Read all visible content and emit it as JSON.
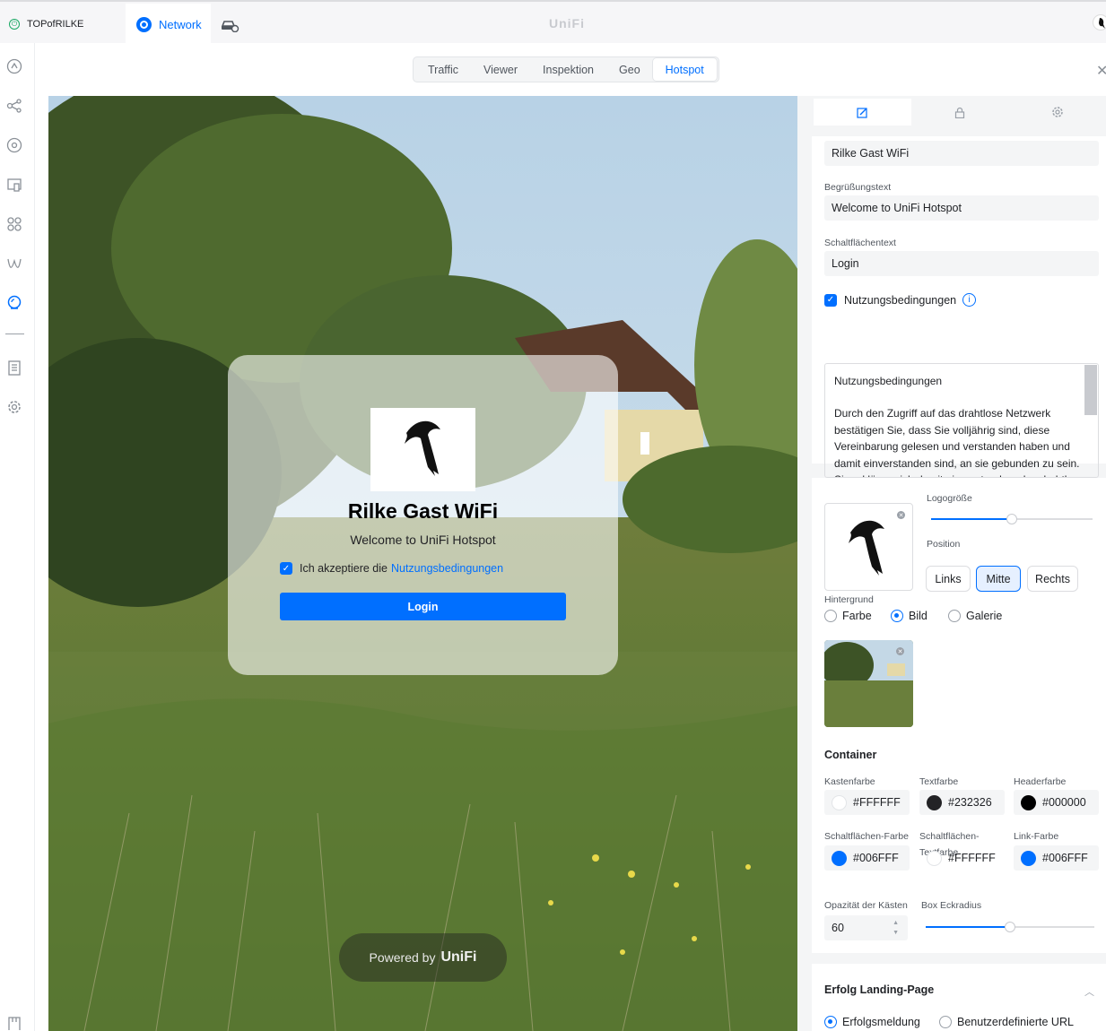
{
  "topbar": {
    "site_name": "TOPofRILKE",
    "app_tab": "Network",
    "brand": "UniFi"
  },
  "view_tabs": [
    "Traffic",
    "Viewer",
    "Inspektion",
    "Geo",
    "Hotspot"
  ],
  "active_view_tab": "Hotspot",
  "portal": {
    "title": "Rilke Gast WiFi",
    "welcome": "Welcome to UniFi Hotspot",
    "accept_prefix": "Ich akzeptiere die",
    "accept_link": "Nutzungsbedingungen",
    "login_button": "Login",
    "powered_by": "Powered by",
    "powered_brand": "UniFi"
  },
  "settings": {
    "title_value": "Rilke Gast WiFi",
    "welcome_label": "Begrüßungstext",
    "welcome_value": "Welcome to UniFi Hotspot",
    "button_label": "Schaltflächentext",
    "button_value": "Login",
    "terms_checkbox": "Nutzungsbedingungen",
    "terms_heading": "Nutzungsbedingungen",
    "terms_body": "Durch den Zugriff auf das drahtlose Netzwerk bestätigen Sie, dass Sie volljährig sind, diese Vereinbarung gelesen und verstanden haben und damit einverstanden sind, an sie gebunden zu sein. Sie erklären sich damit einverstanden, das drahtlose",
    "logo_size_label": "Logogröße",
    "logo_size_fraction": 0.5,
    "position_label": "Position",
    "position_options": [
      "Links",
      "Mitte",
      "Rechts"
    ],
    "position_selected": "Mitte",
    "background_label": "Hintergrund",
    "background_options": [
      "Farbe",
      "Bild",
      "Galerie"
    ],
    "background_selected": "Bild",
    "container_title": "Container",
    "colors": [
      {
        "label": "Kastenfarbe",
        "value": "#FFFFFF",
        "swatch": "#FFFFFF"
      },
      {
        "label": "Textfarbe",
        "value": "#232326",
        "swatch": "#232326"
      },
      {
        "label": "Headerfarbe",
        "value": "#000000",
        "swatch": "#000000"
      },
      {
        "label": "Schaltflächen-Farbe",
        "value": "#006FFF",
        "swatch": "#006FFF"
      },
      {
        "label": "Schaltflächen-Textfarbe",
        "value": "#FFFFFF",
        "swatch": "#FFFFFF"
      },
      {
        "label": "Link-Farbe",
        "value": "#006FFF",
        "swatch": "#006FFF"
      }
    ],
    "opacity_label": "Opazität der Kästen",
    "opacity_value": "60",
    "radius_label": "Box Eckradius",
    "radius_fraction": 0.5,
    "success_title": "Erfolg Landing-Page",
    "success_options": [
      "Erfolgsmeldung",
      "Benutzerdefinierte URL"
    ],
    "success_selected": "Erfolgsmeldung"
  },
  "accent_color": "#006FFF"
}
